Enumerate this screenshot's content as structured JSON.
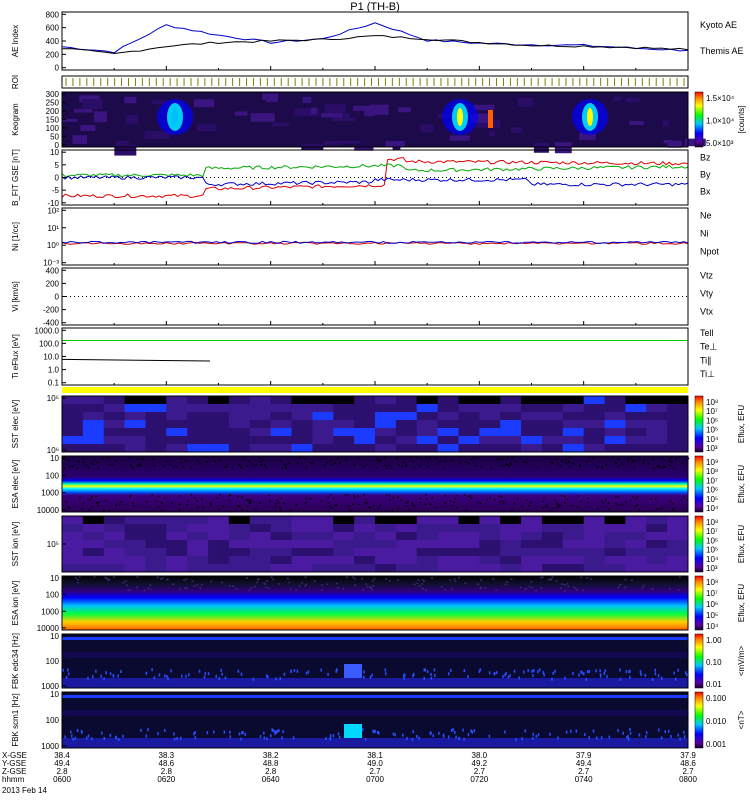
{
  "title": "P1 (TH-B)",
  "colors": {
    "kyoto": "#0000cc",
    "themis": "#000000",
    "bx": "#0000cc",
    "by": "#00aa00",
    "bz": "#dd0000",
    "te": "#00cc00",
    "ti_perp": "#0000cc",
    "tell": "#000000",
    "roi": "#ffff00"
  },
  "panels": [
    {
      "id": "ae",
      "ylabel": "AE Index",
      "yticks": [
        "0",
        "200",
        "400",
        "600",
        "800"
      ],
      "legend": [
        "Kyoto AE",
        "Themis AE"
      ]
    },
    {
      "id": "roi",
      "ylabel": "ROI"
    },
    {
      "id": "keogram",
      "ylabel": "Keogram",
      "yticks": [
        "0",
        "50",
        "100",
        "150",
        "200",
        "250",
        "300"
      ],
      "cb_ticks": [
        "1.5×10⁴",
        "1.0×10⁴",
        "5.0×10³"
      ],
      "cb_label": "[counts]"
    },
    {
      "id": "bfgm",
      "ylabel": "B_FIT GSE [nT]",
      "yticks": [
        "-10",
        "-5",
        "0",
        "5",
        "10"
      ],
      "legend": [
        "Bz",
        "By",
        "Bx"
      ]
    },
    {
      "id": "ni",
      "ylabel": "Ni [1/cc]",
      "yticks": [
        "10⁻³",
        "10⁰",
        "10¹",
        "10²"
      ],
      "legend": [
        "Ne",
        "Ni",
        "Npot"
      ]
    },
    {
      "id": "vi",
      "ylabel": "Vi [km/s]",
      "yticks": [
        "-400",
        "-200",
        "0",
        "200",
        "400"
      ],
      "legend": [
        "Vtz",
        "Vty",
        "Vtx"
      ]
    },
    {
      "id": "ti",
      "ylabel": "Ti eFlux [eV]",
      "yticks": [
        "0.1",
        "1.0",
        "10.0",
        "100.0",
        "1000.0"
      ],
      "legend": [
        "Tell",
        "Te⊥",
        "Ti∥",
        "Ti⊥"
      ]
    },
    {
      "id": "sst_e",
      "ylabel": "SST elec [eV]",
      "yticks": [
        "10⁶",
        "10⁵"
      ],
      "cb_ticks": [
        "10⁸",
        "10⁷",
        "10⁶",
        "10⁵",
        "10⁴",
        "10³"
      ],
      "cb_label": "Eflux, EFU"
    },
    {
      "id": "esa_e",
      "ylabel": "ESA elec [eV]",
      "yticks": [
        "10000",
        "1000",
        "100",
        "10"
      ],
      "cb_ticks": [
        "10⁹",
        "10⁸",
        "10⁷",
        "10⁶",
        "10⁵",
        "10⁴"
      ],
      "cb_label": "Eflux, EFU"
    },
    {
      "id": "sst_i",
      "ylabel": "SST ion [eV]",
      "yticks": [
        "10⁵"
      ],
      "cb_ticks": [
        "10⁸",
        "10⁷",
        "10⁶",
        "10⁵",
        "10⁴",
        "10³"
      ],
      "cb_label": "Eflux, EFU"
    },
    {
      "id": "esa_i",
      "ylabel": "ESA ion [eV]",
      "yticks": [
        "10000",
        "1000",
        "100",
        "10"
      ],
      "cb_ticks": [
        "10⁸",
        "10⁷",
        "10⁶",
        "10⁵",
        "10⁴"
      ],
      "cb_label": "Eflux, EFU"
    },
    {
      "id": "fbk_e",
      "ylabel": "FBK edc34 [Hz]",
      "yticks": [
        "1000",
        "100",
        "10"
      ],
      "cb_ticks": [
        "1.00",
        "0.10",
        "0.01"
      ],
      "cb_label": "<mV/m>"
    },
    {
      "id": "fbk_b",
      "ylabel": "FBK scm1 [Hz]",
      "yticks": [
        "1000",
        "100",
        "10"
      ],
      "cb_ticks": [
        "0.100",
        "0.010",
        "0.001"
      ],
      "cb_label": "<nT>"
    }
  ],
  "footer": {
    "rows": [
      {
        "label": "X-GSE",
        "values": [
          "38.4",
          "38.3",
          "38.2",
          "38.1",
          "38.0",
          "37.9",
          "37.9"
        ]
      },
      {
        "label": "Y-GSE",
        "values": [
          "49.4",
          "48.6",
          "48.8",
          "49.0",
          "49.2",
          "49.4",
          "48.6"
        ]
      },
      {
        "label": "Z-GSE",
        "values": [
          "2.8",
          "2.8",
          "2.8",
          "2.7",
          "2.7",
          "2.7",
          "2.7"
        ]
      },
      {
        "label": "hhmm",
        "values": [
          "0600",
          "0620",
          "0640",
          "0700",
          "0720",
          "0740",
          "0800"
        ]
      }
    ],
    "date": "2013 Feb 14"
  },
  "chart_data": {
    "type": "line",
    "title": "P1 (TH-B)",
    "x": [
      "0600",
      "0610",
      "0620",
      "0630",
      "0640",
      "0650",
      "0700",
      "0710",
      "0720",
      "0730",
      "0740",
      "0750",
      "0800"
    ],
    "xlabel": "hhmm",
    "series": [
      {
        "name": "Kyoto AE",
        "values": [
          320,
          250,
          620,
          480,
          380,
          430,
          650,
          410,
          370,
          350,
          340,
          300,
          270
        ]
      },
      {
        "name": "Themis AE",
        "values": [
          300,
          220,
          330,
          380,
          400,
          420,
          470,
          430,
          380,
          340,
          330,
          310,
          280
        ]
      }
    ],
    "ylabel": "AE Index",
    "ylim": [
      0,
      800
    ],
    "grid": false,
    "legend": "right"
  }
}
